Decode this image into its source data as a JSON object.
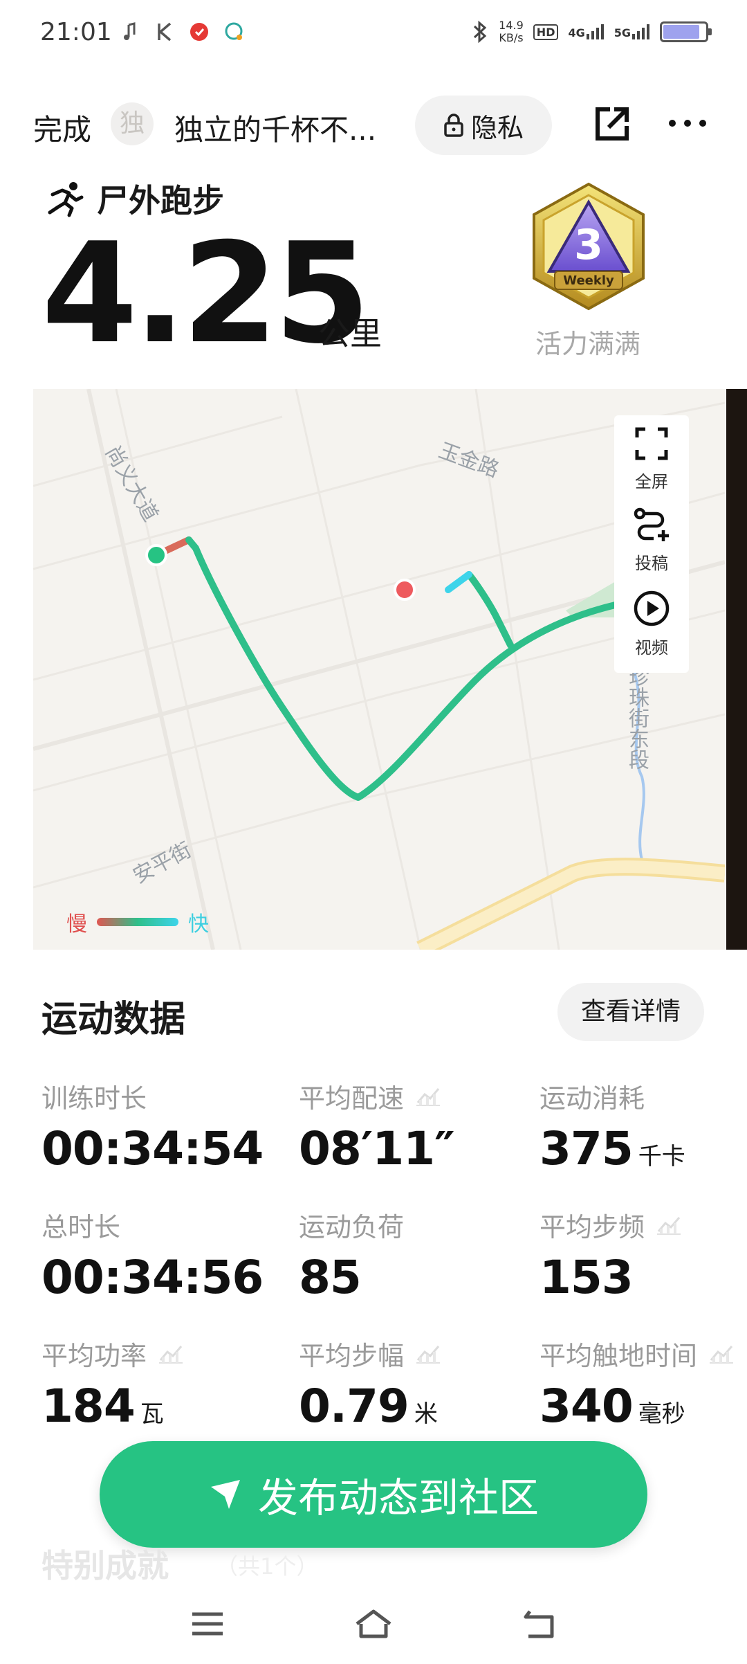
{
  "status_bar": {
    "time": "21:01",
    "net_speed_value": "14.9",
    "net_speed_unit": "KB/s",
    "hd": "HD",
    "sim1": "4G",
    "sim2": "5G"
  },
  "header": {
    "done_label": "完成",
    "avatar_char": "独",
    "username": "独立的千杯不...",
    "privacy_label": "隐私"
  },
  "summary": {
    "sport_type": "尸外跑步",
    "distance": "4.25",
    "distance_unit": "公里",
    "badge_text": "Weekly",
    "badge_label": "活力满满"
  },
  "map": {
    "tools": [
      {
        "label": "全屏",
        "icon": "fullscreen-icon"
      },
      {
        "label": "投稿",
        "icon": "route-add-icon"
      },
      {
        "label": "视频",
        "icon": "play-icon"
      }
    ],
    "legend_slow": "慢",
    "legend_fast": "快",
    "roads": {
      "shangyi": "尚义大道",
      "yujin": "玉金路",
      "zhenzhu": "珍珠街东段",
      "anping": "安平街"
    },
    "route_colors": {
      "track": "#2ebf8a",
      "start": "#26c383",
      "end": "#ee5a5e",
      "fast": "#3dd4ea"
    }
  },
  "stats_section": {
    "title": "运动数据",
    "detail_button": "查看详情",
    "items": [
      {
        "label": "训练时长",
        "value": "00:34:54",
        "unit": "",
        "trend": false
      },
      {
        "label": "平均配速",
        "value": "08′11″",
        "unit": "",
        "trend": true
      },
      {
        "label": "运动消耗",
        "value": "375",
        "unit": "千卡",
        "trend": false
      },
      {
        "label": "总时长",
        "value": "00:34:56",
        "unit": "",
        "trend": false
      },
      {
        "label": "运动负荷",
        "value": "85",
        "unit": "",
        "trend": false
      },
      {
        "label": "平均步频",
        "value": "153",
        "unit": "",
        "trend": true
      },
      {
        "label": "平均功率",
        "value": "184",
        "unit": "瓦",
        "trend": true
      },
      {
        "label": "平均步幅",
        "value": "0.79",
        "unit": "米",
        "trend": true
      },
      {
        "label": "平均触地时间",
        "value": "340",
        "unit": "毫秒",
        "trend": true
      }
    ]
  },
  "publish_button": "发布动态到社区",
  "achievements": {
    "title": "特别成就",
    "count": "（共1个）"
  },
  "colors": {
    "accent": "#26c383",
    "slow": "#e0504f",
    "fast": "#3dcfe0"
  }
}
